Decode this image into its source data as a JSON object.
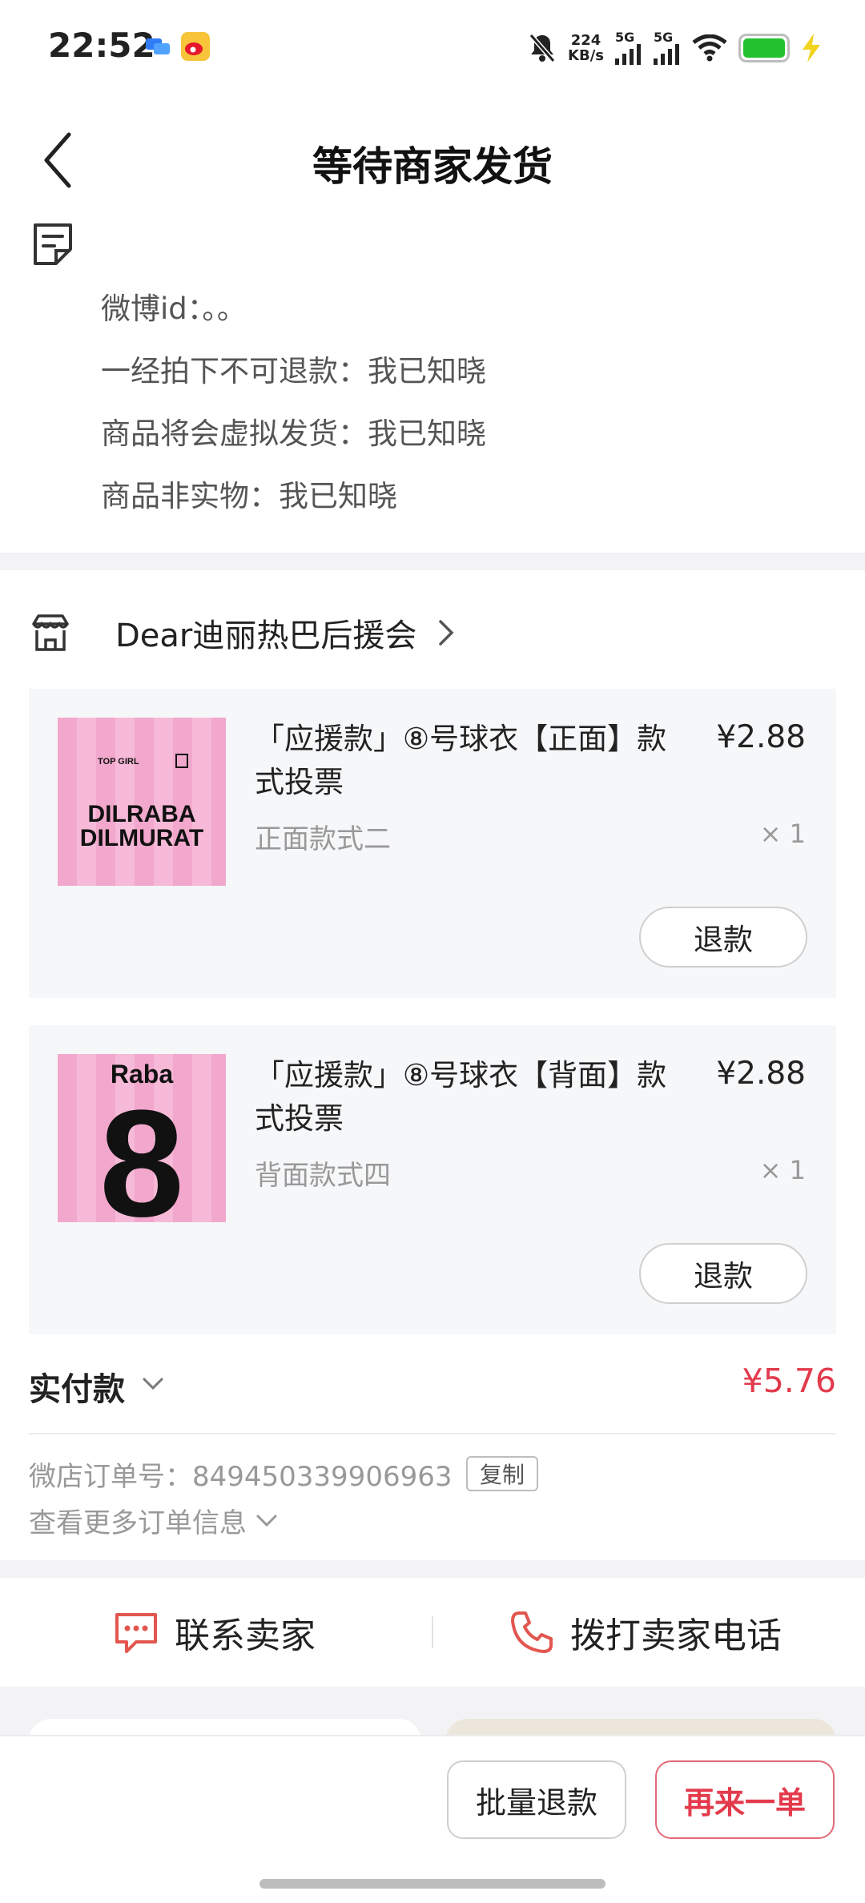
{
  "status_bar": {
    "time": "22:52",
    "net_speed_value": "224",
    "net_speed_unit": "KB/s",
    "sim1_label": "5G",
    "sim2_label": "5G",
    "battery_level_percent": 100,
    "icons": [
      "message-icon",
      "weibo-icon",
      "mute-bell-icon",
      "signal-icon",
      "wifi-icon",
      "battery-icon",
      "charging-icon"
    ]
  },
  "header": {
    "title": "等待商家发货"
  },
  "buyer_note": {
    "lines": [
      "微博id：。。",
      "一经拍下不可退款：我已知晓",
      "商品将会虚拟发货：我已知晓",
      "商品非实物：我已知晓"
    ]
  },
  "shop": {
    "name": "Dear迪丽热巴后援会"
  },
  "items": [
    {
      "title": "「应援款」⑧号球衣【正面】款式投票",
      "price": "¥2.88",
      "spec": "正面款式二",
      "quantity": "× 1",
      "refund_label": "退款",
      "thumb_small_left": "TOP GIRL",
      "thumb_line1": "DILRABA",
      "thumb_line2": "DILMURAT"
    },
    {
      "title": "「应援款」⑧号球衣【背面】款式投票",
      "price": "¥2.88",
      "spec": "背面款式四",
      "quantity": "× 1",
      "refund_label": "退款",
      "thumb_name": "Raba",
      "thumb_number": "8"
    }
  ],
  "payment": {
    "label": "实付款",
    "amount": "¥5.76"
  },
  "order_info": {
    "order_number_text": "微店订单号：849450339906963",
    "copy_label": "复制",
    "more_info_label": "查看更多订单信息"
  },
  "contact": {
    "contact_seller": "联系卖家",
    "call_seller": "拨打卖家电话"
  },
  "bottom_actions": {
    "batch_refund": "批量退款",
    "reorder": "再来一单"
  },
  "colors": {
    "accent_red": "#e33a4c",
    "icon_red": "#e2564f",
    "battery_green": "#22c32e",
    "thumb_pink": "#f6b9d7"
  }
}
